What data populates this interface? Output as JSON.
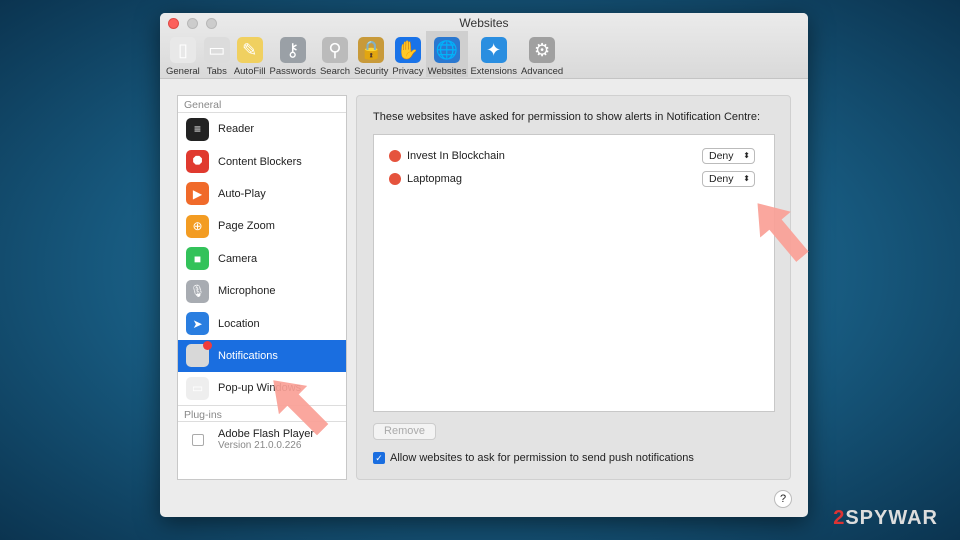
{
  "window": {
    "title": "Websites"
  },
  "toolbar": [
    {
      "label": "General",
      "icon": "general-switch-icon",
      "color": "#e8e8e8",
      "glyph": "▯"
    },
    {
      "label": "Tabs",
      "icon": "tabs-icon",
      "color": "#dcdcdc",
      "glyph": "▭"
    },
    {
      "label": "AutoFill",
      "icon": "pencil-icon",
      "color": "#f0d060",
      "glyph": "✎"
    },
    {
      "label": "Passwords",
      "icon": "key-icon",
      "color": "#9aa0a6",
      "glyph": "⚷"
    },
    {
      "label": "Search",
      "icon": "magnifier-icon",
      "color": "#bbbbbb",
      "glyph": "⚲"
    },
    {
      "label": "Security",
      "icon": "lock-icon",
      "color": "#c89a3a",
      "glyph": "🔒"
    },
    {
      "label": "Privacy",
      "icon": "hand-icon",
      "color": "#1a73e8",
      "glyph": "✋"
    },
    {
      "label": "Websites",
      "icon": "globe-icon",
      "color": "#2a78d0",
      "glyph": "🌐"
    },
    {
      "label": "Extensions",
      "icon": "compass-puzzle-icon",
      "color": "#2a8ee0",
      "glyph": "✦"
    },
    {
      "label": "Advanced",
      "icon": "gear-icon",
      "color": "#a0a0a0",
      "glyph": "⚙"
    }
  ],
  "selected_tab": "Websites",
  "sidebar": {
    "general_header": "General",
    "items": [
      {
        "label": "Reader",
        "icon": "reader-icon",
        "color": "#222222",
        "glyph": "≡"
      },
      {
        "label": "Content Blockers",
        "icon": "stop-sign-icon",
        "color": "#e03a2f",
        "glyph": "⯃"
      },
      {
        "label": "Auto-Play",
        "icon": "play-icon",
        "color": "#f06a2a",
        "glyph": "▶"
      },
      {
        "label": "Page Zoom",
        "icon": "zoom-icon",
        "color": "#f39c22",
        "glyph": "⊕"
      },
      {
        "label": "Camera",
        "icon": "camera-icon",
        "color": "#33c25a",
        "glyph": "■"
      },
      {
        "label": "Microphone",
        "icon": "microphone-icon",
        "color": "#a8acb2",
        "glyph": "🎙"
      },
      {
        "label": "Location",
        "icon": "location-arrow-icon",
        "color": "#2a7ee0",
        "glyph": "➤"
      },
      {
        "label": "Notifications",
        "icon": "notifications-icon",
        "color": "#d8d8d8",
        "glyph": ""
      },
      {
        "label": "Pop-up Windows",
        "icon": "popup-windows-icon",
        "color": "#eeeeee",
        "glyph": "▭"
      }
    ],
    "selected": "Notifications",
    "plugins_header": "Plug-ins",
    "plugin": {
      "name": "Adobe Flash Player",
      "version": "Version 21.0.0.226",
      "checked": false
    }
  },
  "main": {
    "description": "These websites have asked for permission to show alerts in Notification Centre:",
    "sites": [
      {
        "name": "Invest In Blockchain",
        "permission": "Deny"
      },
      {
        "name": "Laptopmag",
        "permission": "Deny"
      }
    ],
    "remove_label": "Remove",
    "allow_label": "Allow websites to ask for permission to send push notifications",
    "allow_checked": true,
    "help": "?"
  },
  "watermark": {
    "prefix": "2",
    "text": "SPYWAR"
  }
}
